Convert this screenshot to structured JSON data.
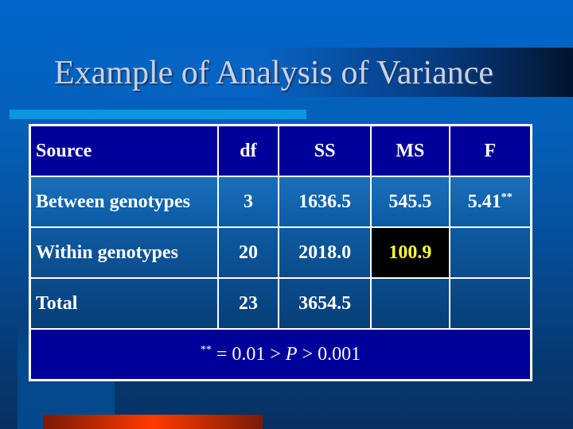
{
  "slide": {
    "title": "Example of Analysis of Variance"
  },
  "table": {
    "headers": {
      "source": "Source",
      "df": "df",
      "ss": "SS",
      "ms": "MS",
      "f": "F"
    },
    "rows": [
      {
        "source": "Between genotypes",
        "df": "3",
        "ss": "1636.5",
        "ms": "545.5",
        "f": "5.41",
        "f_sup": "**"
      },
      {
        "source": "Within genotypes",
        "df": "20",
        "ss": "2018.0",
        "ms": "100.9",
        "f": ""
      },
      {
        "source": "Total",
        "df": "23",
        "ss": "3654.5",
        "ms": "",
        "f": ""
      }
    ],
    "footnote": {
      "marker": "**",
      "text_before": " = 0.01 > ",
      "p_symbol": "P",
      "text_after": " > 0.001"
    }
  },
  "colors": {
    "header_bg": "#00009a",
    "highlight_bg": "#000000",
    "highlight_text": "#ffff33",
    "accent_bar": "#0a96dc",
    "bottom_bar": "#ff3a00"
  }
}
